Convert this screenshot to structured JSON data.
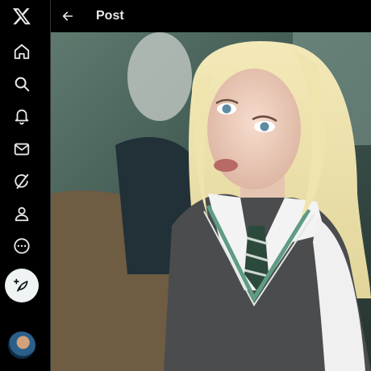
{
  "header": {
    "title": "Post"
  },
  "sidebar": {
    "items": [
      {
        "name": "x-logo-icon"
      },
      {
        "name": "home-icon"
      },
      {
        "name": "search-icon"
      },
      {
        "name": "notifications-bell-icon"
      },
      {
        "name": "messages-envelope-icon"
      },
      {
        "name": "grok-icon"
      },
      {
        "name": "profile-person-icon"
      },
      {
        "name": "more-circle-icon"
      }
    ],
    "compose_icon": "feather-plus-icon"
  },
  "colors": {
    "background": "#000000",
    "text": "#e7e9ea",
    "compose_button": "#eff3f4",
    "divider": "#2f3336"
  }
}
